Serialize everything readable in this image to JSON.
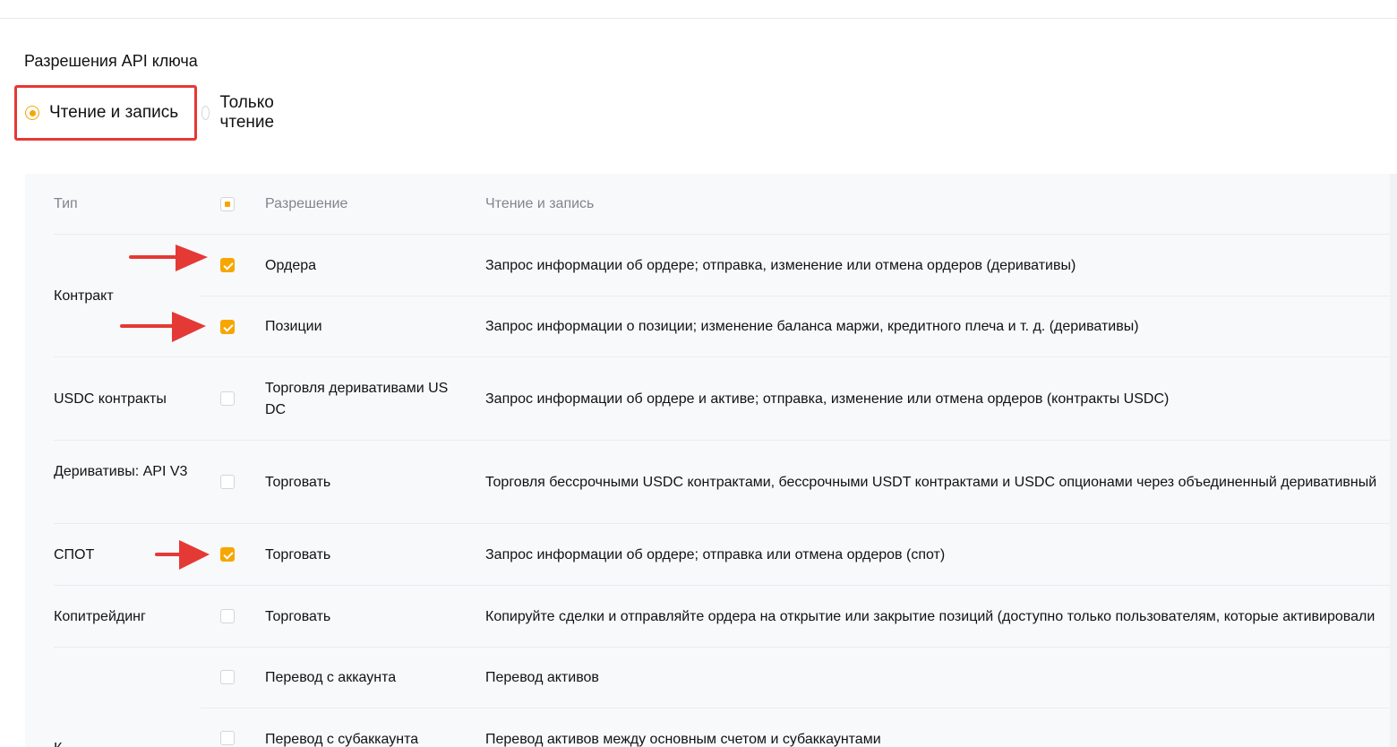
{
  "section_title": "Разрешения API ключа",
  "permission_modes": [
    {
      "label": "Чтение и запись",
      "selected": true
    },
    {
      "label": "Только чтение",
      "selected": false
    }
  ],
  "table": {
    "headers": {
      "type": "Тип",
      "permission": "Разрешение",
      "description": "Чтение и запись"
    },
    "header_checkbox_state": "partial",
    "rows": [
      {
        "type": "Контракт",
        "permission": "Ордера",
        "description": "Запрос информации об ордере; отправка, изменение или отмена ордеров (деривативы)",
        "checked": true
      },
      {
        "type": "",
        "permission": "Позиции",
        "description": "Запрос информации о позиции; изменение баланса маржи, кредитного плеча и т. д. (деривативы)",
        "checked": true
      },
      {
        "type": "USDC контракты",
        "permission": "Торговля деривативами USDC",
        "description": "Запрос информации об ордере и активе; отправка, изменение или отмена ордеров (контракты USDC)",
        "checked": false
      },
      {
        "type": "Деривативы: API V3",
        "permission": "Торговать",
        "description": "Торговля бессрочными USDC контрактами, бессрочными USDT контрактами и USDC опционами через объединенный деривативный",
        "checked": false
      },
      {
        "type": "СПОТ",
        "permission": "Торговать",
        "description": "Запрос информации об ордере; отправка или отмена ордеров (спот)",
        "checked": true
      },
      {
        "type": "Копитрейдинг",
        "permission": "Торговать",
        "description": "Копируйте сделки и отправляйте ордера на открытие или закрытие позиций (доступно только пользователям, которые активировали",
        "checked": false
      },
      {
        "type": "",
        "permission": "Перевод с аккаунта",
        "description": "Перевод активов",
        "checked": false
      },
      {
        "type": "К",
        "permission": "Перевод с субаккаунта",
        "description": "Перевод активов между основным счетом и субаккаунтами",
        "checked": false
      }
    ]
  },
  "colors": {
    "accent": "#f7a600",
    "highlight_box": "#e53935",
    "annotation_arrow": "#e53935"
  }
}
